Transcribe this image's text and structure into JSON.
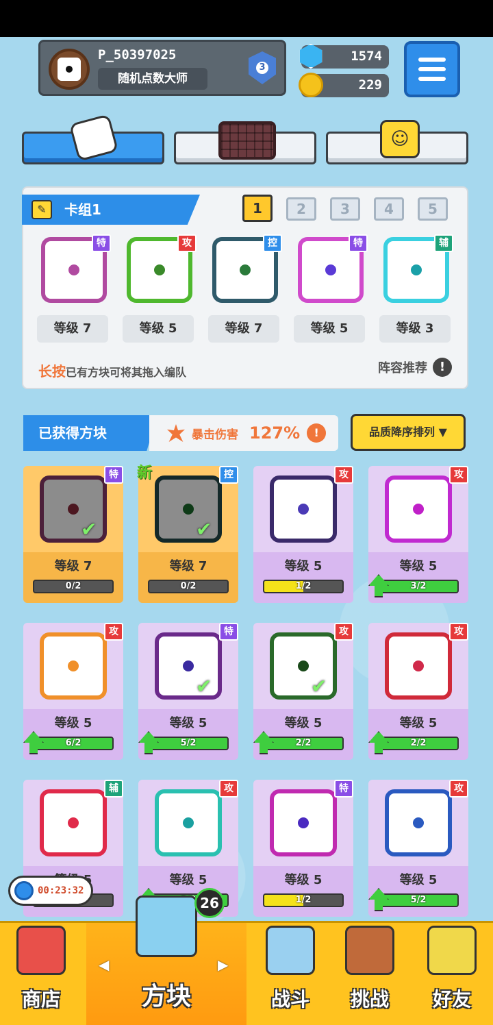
{
  "player": {
    "name": "P_50397025",
    "title": "随机点数大师",
    "rank": "3"
  },
  "currency": {
    "gems": "1574",
    "coins": "229"
  },
  "deck": {
    "title": "卡组1",
    "numbers": [
      "1",
      "2",
      "3",
      "4",
      "5"
    ],
    "active_number": "1",
    "slots": [
      {
        "type": "特",
        "level": "等级 7",
        "color": "#b04aa0",
        "pip": "#b04aa0"
      },
      {
        "type": "攻",
        "level": "等级 5",
        "color": "#4fb82e",
        "pip": "#3a8a2a"
      },
      {
        "type": "控",
        "level": "等级 7",
        "color": "#2f5a6a",
        "pip": "#2a7a3a"
      },
      {
        "type": "特",
        "level": "等级 5",
        "color": "#d04acb",
        "pip": "#5a3ad6"
      },
      {
        "type": "辅",
        "level": "等级 3",
        "color": "#3ad0e0",
        "pip": "#1aa0a8"
      }
    ],
    "hint_bold": "长按",
    "hint_text": "已有方块可将其拖入编队",
    "recommend": "阵容推荐",
    "recommend_icon": "!"
  },
  "owned": {
    "title": "已获得方块",
    "crit_label": "暴击伤害",
    "crit_value": "127%",
    "crit_icon": "!",
    "sort_label": "品质降序排列 ▼",
    "cards": [
      {
        "type": "特",
        "level": "等级 7",
        "progress": "0/2",
        "equipped": true,
        "checked": true,
        "is_new": false,
        "upgrade": false,
        "color": "#8a3a6a",
        "pip": "#8a2a3a",
        "fill": 0,
        "fill_color": "#888"
      },
      {
        "type": "控",
        "level": "等级 7",
        "progress": "0/2",
        "equipped": true,
        "checked": true,
        "is_new": true,
        "upgrade": false,
        "color": "#244a4a",
        "pip": "#1a6a2a",
        "fill": 0,
        "fill_color": "#888"
      },
      {
        "type": "攻",
        "level": "等级 5",
        "progress": "1/2",
        "equipped": false,
        "checked": false,
        "is_new": false,
        "upgrade": false,
        "color": "#3a2a6a",
        "pip": "#4a3ab6",
        "fill": 0.5,
        "fill_color": "#f4e21a"
      },
      {
        "type": "攻",
        "level": "等级 5",
        "progress": "3/2",
        "equipped": false,
        "checked": false,
        "is_new": false,
        "upgrade": true,
        "color": "#c02ad0",
        "pip": "#c020c8",
        "fill": 1,
        "fill_color": "#3fce3f"
      },
      {
        "type": "攻",
        "level": "等级 5",
        "progress": "6/2",
        "equipped": false,
        "checked": false,
        "is_new": false,
        "upgrade": true,
        "color": "#f0902a",
        "pip": "#f0902a",
        "fill": 1,
        "fill_color": "#3fce3f"
      },
      {
        "type": "特",
        "level": "等级 5",
        "progress": "5/2",
        "equipped": false,
        "checked": true,
        "is_new": false,
        "upgrade": true,
        "color": "#6a2a8a",
        "pip": "#3a2aa0",
        "fill": 1,
        "fill_color": "#3fce3f"
      },
      {
        "type": "攻",
        "level": "等级 5",
        "progress": "2/2",
        "equipped": false,
        "checked": true,
        "is_new": false,
        "upgrade": true,
        "color": "#2a6a2a",
        "pip": "#1a4a1a",
        "fill": 1,
        "fill_color": "#3fce3f"
      },
      {
        "type": "攻",
        "level": "等级 5",
        "progress": "2/2",
        "equipped": false,
        "checked": false,
        "is_new": false,
        "upgrade": true,
        "color": "#d02a3a",
        "pip": "#d02a4a",
        "fill": 1,
        "fill_color": "#3fce3f"
      },
      {
        "type": "辅",
        "level": "等级 5",
        "progress": "",
        "equipped": false,
        "checked": false,
        "is_new": false,
        "upgrade": false,
        "color": "#e02a4a",
        "pip": "#e02a4a",
        "fill": 0,
        "fill_color": "#888"
      },
      {
        "type": "攻",
        "level": "等级 5",
        "progress": "5/2",
        "equipped": false,
        "checked": false,
        "is_new": false,
        "upgrade": true,
        "color": "#2ac0b0",
        "pip": "#1aa0a0",
        "fill": 1,
        "fill_color": "#3fce3f"
      },
      {
        "type": "特",
        "level": "等级 5",
        "progress": "1/2",
        "equipped": false,
        "checked": false,
        "is_new": false,
        "upgrade": false,
        "color": "#c02ab0",
        "pip": "#4a2ac0",
        "fill": 0.5,
        "fill_color": "#f4e21a"
      },
      {
        "type": "攻",
        "level": "等级 5",
        "progress": "5/2",
        "equipped": false,
        "checked": false,
        "is_new": false,
        "upgrade": true,
        "color": "#2a5ac0",
        "pip": "#2a5ac0",
        "fill": 1,
        "fill_color": "#3fce3f"
      }
    ]
  },
  "timer": "00:23:32",
  "box_badge": "26",
  "nav": {
    "shop": "商店",
    "blocks": "方块",
    "battle": "战斗",
    "challenge": "挑战",
    "friends": "好友",
    "left_arrow": "◀",
    "right_arrow": "▶"
  }
}
